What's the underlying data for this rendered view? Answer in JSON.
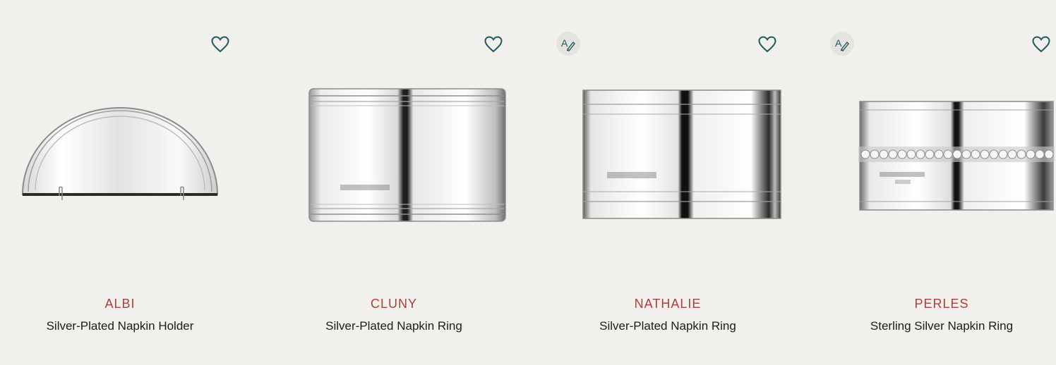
{
  "products": [
    {
      "name": "ALBI",
      "description": "Silver-Plated Napkin Holder",
      "engravable": false,
      "wishlist_icon": "heart-outline-icon"
    },
    {
      "name": "CLUNY",
      "description": "Silver-Plated Napkin Ring",
      "engravable": false,
      "wishlist_icon": "heart-outline-icon"
    },
    {
      "name": "NATHALIE",
      "description": "Silver-Plated Napkin Ring",
      "engravable": true,
      "engrave_icon": "engraving-pen-icon",
      "wishlist_icon": "heart-outline-icon"
    },
    {
      "name": "PERLES",
      "description": "Sterling Silver Napkin Ring",
      "engravable": true,
      "engrave_icon": "engraving-pen-icon",
      "wishlist_icon": "heart-outline-icon"
    }
  ],
  "colors": {
    "background": "#f1f0ed",
    "product_name": "#a8423d",
    "description": "#1c1c1c",
    "icon": "#1d5a60"
  }
}
